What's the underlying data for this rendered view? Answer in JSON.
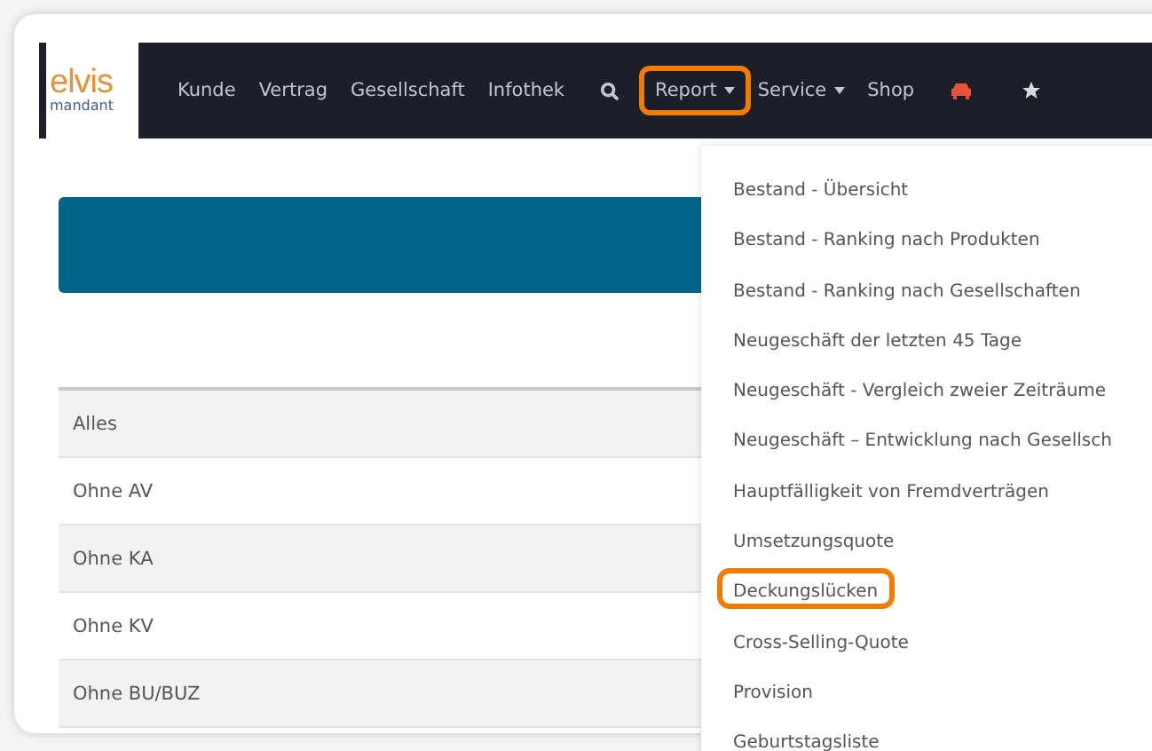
{
  "logo": {
    "brand": "elvis",
    "sub": "mandant"
  },
  "nav": [
    {
      "kind": "link",
      "label": "Kunde",
      "highlighted": false
    },
    {
      "kind": "link",
      "label": "Vertrag",
      "highlighted": false
    },
    {
      "kind": "link",
      "label": "Gesellschaft",
      "highlighted": false
    },
    {
      "kind": "link",
      "label": "Infothek",
      "highlighted": false
    },
    {
      "kind": "search",
      "highlighted": false
    },
    {
      "kind": "dropdown",
      "label": "Report",
      "highlighted": true
    },
    {
      "kind": "dropdown",
      "label": "Service",
      "highlighted": false
    },
    {
      "kind": "link",
      "label": "Shop",
      "highlighted": false
    },
    {
      "kind": "car",
      "highlighted": false
    },
    {
      "kind": "star",
      "highlighted": false
    }
  ],
  "table": {
    "rows": [
      {
        "label": "Alles"
      },
      {
        "label": "Ohne AV"
      },
      {
        "label": "Ohne KA"
      },
      {
        "label": "Ohne KV"
      },
      {
        "label": "Ohne BU/BUZ"
      }
    ]
  },
  "report_menu": {
    "items": [
      {
        "label": "Bestand - Übersicht",
        "highlighted": false
      },
      {
        "label": "Bestand - Ranking nach Produkten",
        "highlighted": false
      },
      {
        "label": "Bestand - Ranking nach Gesellschaften",
        "highlighted": false
      },
      {
        "label": "Neugeschäft der letzten 45 Tage",
        "highlighted": false
      },
      {
        "label": "Neugeschäft - Vergleich zweier Zeiträume",
        "highlighted": false
      },
      {
        "label": "Neugeschäft – Entwicklung nach Gesellsch",
        "highlighted": false
      },
      {
        "label": "Hauptfälligkeit von Fremdverträgen",
        "highlighted": false
      },
      {
        "label": "Umsetzungsquote",
        "highlighted": false
      },
      {
        "label": "Deckungslücken",
        "highlighted": true
      },
      {
        "label": "Cross-Selling-Quote",
        "highlighted": false
      },
      {
        "label": "Provision",
        "highlighted": false
      },
      {
        "label": "Geburtstagsliste",
        "highlighted": false
      }
    ]
  }
}
